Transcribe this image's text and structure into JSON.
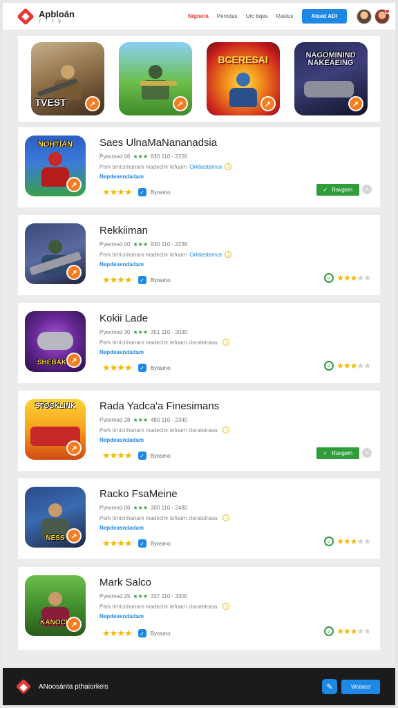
{
  "header": {
    "app_name": "Apbloán",
    "app_sub": "ƒ r 1 g",
    "nav": [
      "Nignera",
      "Perndas",
      "Urc bqes",
      "Rastus"
    ],
    "primary_button": "Alsed ADI"
  },
  "featured": [
    {
      "title": "TVEST",
      "icon": "rifle-soldier-art"
    },
    {
      "title": "",
      "icon": "armored-soldier-art"
    },
    {
      "title": "BCERESAI",
      "icon": "flame-hero-art"
    },
    {
      "title": "NAGOMININD NAKEAEING",
      "icon": "space-car-art"
    }
  ],
  "apps": [
    {
      "name": "Saes UlnaMaNananadsia",
      "meta": "Pyecmed 06",
      "meta2": "830 110 - 2226",
      "desc": "Perk tirnicnhanam madeclnr tefuam",
      "desc_hl": "Orktiestemce",
      "link": "Nepdeasndadam",
      "verified": "Byosmo",
      "action": "install",
      "action_label": "Ravgem",
      "rating_right": 0,
      "thumb_title": "NOHTIAN"
    },
    {
      "name": "Rekkiiman",
      "meta": "Pyecmed 00",
      "meta2": "830 110 - 2236",
      "desc": "Perk tirnicnhanam madeclnr tefuam",
      "desc_hl": "Orktiestemce",
      "link": "Nepdeasndadam",
      "verified": "Byosmo",
      "action": "rating",
      "action_label": "",
      "rating_right": 3,
      "thumb_title": ""
    },
    {
      "name": "Kokii Lade",
      "meta": "Pyecmed 30",
      "meta2": "351 110 - 2030",
      "desc": "Perk tirnicnhanam madeclnr tefuam cluratetrasa",
      "desc_hl": "",
      "link": "Nepdeasndadam",
      "verified": "Byosmo",
      "action": "rating",
      "action_label": "",
      "rating_right": 3,
      "thumb_title": "SHEBAKKI"
    },
    {
      "name": "Rada Yadca'a Finesimans",
      "meta": "Pyecmed 28",
      "meta2": "480 110 - 2340",
      "desc": "Perk tirnicnhanam madeclnr tefuam cluratetrasa",
      "desc_hl": "",
      "link": "Nepdeasndadam",
      "verified": "Byosmo",
      "action": "install",
      "action_label": "Ravgem",
      "rating_right": 0,
      "thumb_title": "STOCKLINK"
    },
    {
      "name": "Racko FsaMeine",
      "meta": "Pyecmed 06",
      "meta2": "300 110 - 2480",
      "desc": "Perk tirnicnhanam madeclnr tefuam cluratetrasa",
      "desc_hl": "",
      "link": "Nepdeasndadam",
      "verified": "Byosmo",
      "action": "rating",
      "action_label": "",
      "rating_right": 3,
      "thumb_title": "NESS"
    },
    {
      "name": "Mark Salco",
      "meta": "Pyecmed 25",
      "meta2": "337 110 - 3300",
      "desc": "Perk tirnicnhanam madeclnr tefuam cluratetrasa",
      "desc_hl": "",
      "link": "Nepdeasndadam",
      "verified": "Byosmo",
      "action": "rating",
      "action_label": "",
      "rating_right": 3,
      "thumb_title": "KANOCU"
    }
  ],
  "footer": {
    "text": "ANoosánta pthaiorkeis",
    "button": "Wolsecl"
  },
  "colors": {
    "accent": "#1e88e5",
    "brand": "#e53935",
    "install": "#2e9d3a",
    "star": "#f5b800"
  }
}
